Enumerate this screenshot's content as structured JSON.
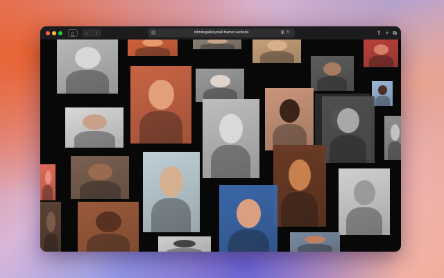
{
  "browser": {
    "url": "infinitegallerywall.framer.website",
    "sidebar_icon": "sidebar-icon",
    "back_icon": "chevron-left-icon",
    "forward_icon": "chevron-right-icon",
    "reader_icon": "reader-icon",
    "translate_icon": "translate-icon",
    "reload_icon": "reload-icon",
    "share_icon": "share-icon",
    "new_tab_icon": "plus-icon",
    "tabs_icon": "tabs-overview-icon"
  },
  "gallery": {
    "photos": [
      {
        "name": "bw-woman-hand-on-cheek",
        "bg": "#b9b9b9",
        "face": "#d8d8d8"
      },
      {
        "name": "orange-portrait-top",
        "bg": "#d5643c",
        "face": "#e49a6c"
      },
      {
        "name": "man-neutral-top",
        "bg": "#8a8076",
        "face": "#c9a48a"
      },
      {
        "name": "person-shoulder-top",
        "bg": "#c9a27a",
        "face": "#d8b08a"
      },
      {
        "name": "red-top-right",
        "bg": "#b8403a",
        "face": "#d6806a"
      },
      {
        "name": "man-black-jacket",
        "bg": "#5c5c5c",
        "face": "#a57c60"
      },
      {
        "name": "double-exposure-redhead",
        "bg": "#c86444",
        "face": "#e2a07a"
      },
      {
        "name": "young-man-grey",
        "bg": "#9a9a9a",
        "face": "#e0d4cc"
      },
      {
        "name": "man-blue-background",
        "bg": "#9ab6d6",
        "face": "#4a3028"
      },
      {
        "name": "bw-man-crouch-small",
        "bg": "#2a2a2a",
        "face": "#888"
      },
      {
        "name": "woman-black-hat",
        "bg": "#d8d8d8",
        "face": "#c8a08a"
      },
      {
        "name": "bw-young-man-portrait",
        "bg": "#bdbdbd",
        "face": "#d9d9d9"
      },
      {
        "name": "woman-flower-tan",
        "bg": "#c9957a",
        "face": "#3a2418"
      },
      {
        "name": "bw-woman-doorway",
        "bg": "#4e4e4e",
        "face": "#a8a8a8"
      },
      {
        "name": "bw-woman-right-edge",
        "bg": "#8e8e8e",
        "face": "#c2c2c2"
      },
      {
        "name": "man-curly-dark",
        "bg": "#7a6050",
        "face": "#9a6a4e"
      },
      {
        "name": "man-crouching-beige",
        "bg": "#bfcfd6",
        "face": "#d4b090"
      },
      {
        "name": "woman-freckles-red",
        "bg": "#6a3a24",
        "face": "#c8804e"
      },
      {
        "name": "woman-bw-black-hair",
        "bg": "#d0d0d0",
        "face": "#9a9a9a"
      },
      {
        "name": "woman-blue-background",
        "bg": "#3a66a8",
        "face": "#d8a080"
      },
      {
        "name": "bald-woman-warm",
        "bg": "#9a5a3a",
        "face": "#5a3020"
      },
      {
        "name": "bw-man-bottom",
        "bg": "#cfcfcf",
        "face": "#444"
      },
      {
        "name": "man-bottom-right",
        "bg": "#7a8aa0",
        "face": "#c08060"
      },
      {
        "name": "red-edge-left",
        "bg": "#e06a5a",
        "face": "#e69080"
      },
      {
        "name": "dark-edge-left",
        "bg": "#5a4034",
        "face": "#7a5a48"
      }
    ]
  }
}
